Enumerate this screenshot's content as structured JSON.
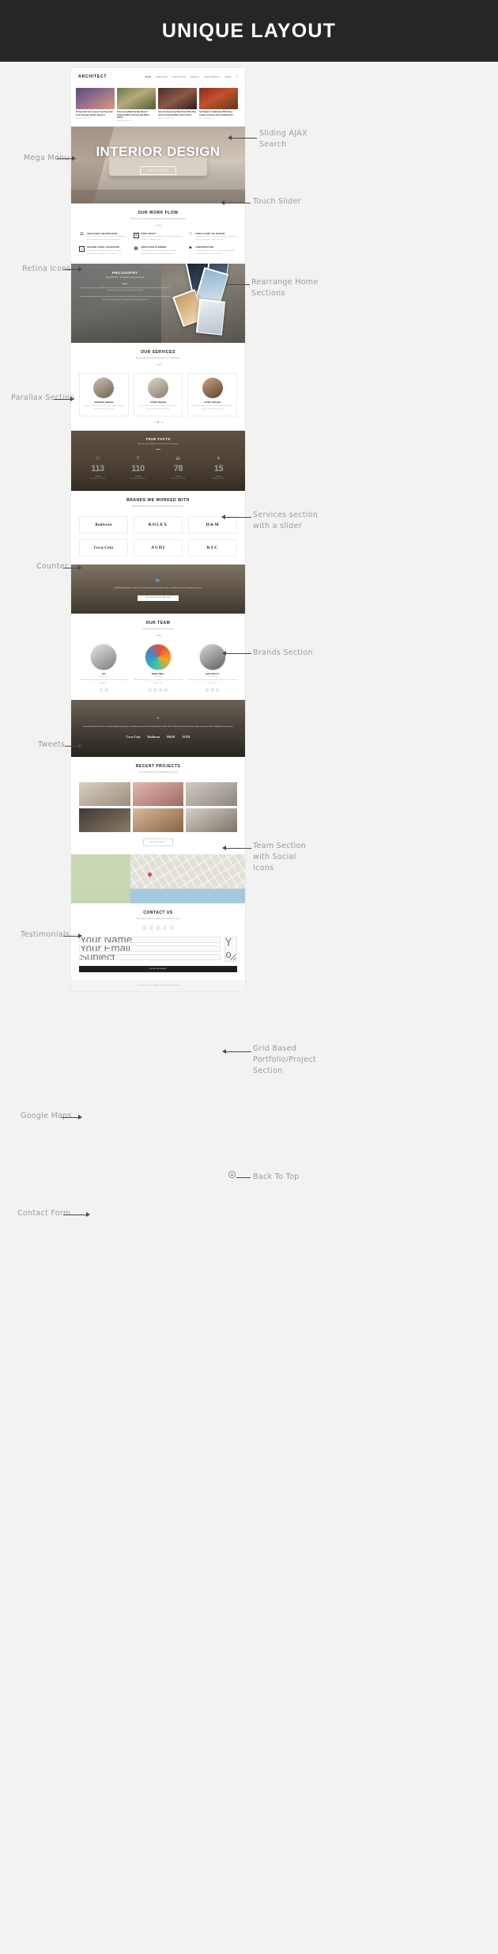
{
  "banner": {
    "title": "UNIQUE LAYOUT"
  },
  "site": {
    "logo": "ARCHITECT",
    "nav": [
      {
        "label": "HOME",
        "icon": "home-icon"
      },
      {
        "label": "SERVICES"
      },
      {
        "label": "PORTFOLIO"
      },
      {
        "label": "PAGES ▾"
      },
      {
        "label": "MEGA MENU ▾"
      },
      {
        "label": "BLOG"
      }
    ],
    "search_icon": "search-icon"
  },
  "mega_menu": {
    "posts": [
      {
        "title": "25 Important Life Lessons You Can Learn From 'Stranger Things' Season 4",
        "meta": "March 26, 2016   •   175"
      },
      {
        "title": "These Incredible Portraits Weren't Captured With A Camera, But With A Pencil.",
        "meta": "March 26, 2016   •   175"
      },
      {
        "title": "Here Are Some Cats Who Prove Why They Aren't Considered Man's Best Friend.",
        "meta": "March 26, 2016   •   175"
      },
      {
        "title": "Get Ready For Halloween With These Couple Costumes That Actually Rock.",
        "meta": "March 26, 2016   •   175"
      }
    ]
  },
  "hero": {
    "title": "INTERIOR DESIGN",
    "button": "OUR PORTFOLIO"
  },
  "workflow": {
    "title": "OUR WORK FLOW",
    "subtitle": "Pushing the boundaries between\nprogressive and innovative.",
    "items": [
      {
        "icon": "☰",
        "heading": "ANALYZING THE PROGRAM",
        "text": "Lorem ipsum dolor sit amet, consectetur adipiscing elit. Suspendisse ut tortor sed velit tempus."
      },
      {
        "icon": "⊕",
        "heading": "FIRST DRAFT",
        "text": "Interdum et malesuada fames ac ante ipsum primis in faucibus. Vestibulum ante."
      },
      {
        "icon": "♡",
        "heading": "FIRST CLIENT VALIDATION",
        "text": "Nam laoreet neque sed dignissim blandit. Ut tincidunt ligula at nisl pretium, sed luctus velit."
      },
      {
        "icon": "✓",
        "heading": "SECOND CLIENT VALIDATION",
        "text": "Donec rhoncus leo vitae lorem egestas, eget dignissim nunc sodales in hac habitasse."
      },
      {
        "icon": "▦",
        "heading": "EXECUTION PLANNING",
        "text": "Phasellus sed quam vel nibh maximus tempor. Praesent ac mauris et nisl semper posuere."
      },
      {
        "icon": "⚑",
        "heading": "CONSTRUCTION",
        "text": "Curabitur vitae lacus in nunc gravida efficitur. Morbi vel erat non justo tincidunt ornare."
      }
    ]
  },
  "philosophy": {
    "title": "PHILOSOPHY",
    "quote": "\"Sky is the limit\" - the\nwords we live and work by.",
    "paragraph1": "Integer sit amet ligula turpis. Aliquam erat volutpat. Maecenas volutpat sapien eu velit suscipit facilisis consectetur. Donec sit amet lectus mauris interdum gravida mi at ipsum.",
    "paragraph2": "Interdum et malesuada fames ac ante ipsum primis in faucibus. Nulla nec lorem nisl sed commodo pulvinar est in malesuade lorem ipsum at quam posuere, egestas tellus id consequat felis."
  },
  "services": {
    "title": "OUR SERVICES",
    "subtitle": "We provide top notch services\nfor our customers.",
    "items": [
      {
        "heading": "INTERIOR DESIGN",
        "text": "Lorem ipsum dolor sit amet, consectetur adipiscing elit quis nulla facilisi vel sem ut augue."
      },
      {
        "heading": "STORE DESIGN",
        "text": "Donec rhoncus leo vitae lorem egestas, eget dignissim nunc sodales at non nisl semper."
      },
      {
        "heading": "HOTEL DESIGN",
        "text": "Phasellus sed quam vel nibh maximus tempor. Praesent ac mauris et nisl semper posuere."
      }
    ],
    "slider_dots": 3,
    "slider_active": 1
  },
  "counter": {
    "title": "TRUE FACTS",
    "subtitle": "Here are some simple, true facts\nabout our company.",
    "items": [
      {
        "icon": "☑",
        "value": "113",
        "label": "PROJECTS DONE"
      },
      {
        "icon": "⏱",
        "value": "110",
        "label": "HOURS WORKED"
      },
      {
        "icon": "☕",
        "value": "78",
        "label": "CUPS OF COFFEE"
      },
      {
        "icon": "♟",
        "value": "15",
        "label": "AWARDS WON"
      }
    ]
  },
  "brands": {
    "title": "BRANDS WE WORKED WITH",
    "subtitle": "We've worked with many great\ncompanies over the years.",
    "items": [
      "Radisson",
      "ROLEX",
      "H&M",
      "Coca-Cola",
      "AUDI",
      "KFC"
    ]
  },
  "tweets": {
    "icon": "twitter-bird-icon",
    "text": "@WPThemeHi please contact us on support team@michaelastou.com, our affiliate was are fine without any issue.",
    "button": "FOLLOW US ON TWITTER"
  },
  "team": {
    "title": "OUR TEAM",
    "subtitle": "Group of people behind the\nmagic.",
    "members": [
      {
        "name": "MIA",
        "role": "Lead Designer",
        "text": "Vestibulum ante ipsum primis in faucibus orci luctus et ultrices posuere cubilia curae.",
        "socials": 2
      },
      {
        "name": "BRAD PINKY",
        "role": "Art Director",
        "text": "Vestibulum ante ipsum primis in faucibus orci luctus et ultrices posuere cubilia curae.",
        "socials": 4
      },
      {
        "name": "SAM SPACIAL",
        "role": "Project Manager",
        "text": "Vestibulum ante ipsum primis in faucibus orci luctus et ultrices posuere cubilia curae.",
        "socials": 3
      }
    ]
  },
  "testimonials": {
    "quote_glyph": "”",
    "text": "Lorem ipsum dolor sit amet, consectetur adipiscing elit, quis commodo monoconsilh, non tincidunt dolo melon sed. Vestibulum ante ipsum donec neque mauris quis nulla, vestibulum ante ipsum at.",
    "logos": [
      "Coca-Cola",
      "Radisson",
      "H&M",
      "AUDI"
    ]
  },
  "projects": {
    "title": "RECENT PROJECTS",
    "subtitle": "Our newest and most outstanding\nprojects.",
    "count": 6,
    "button": "ALL PROJECTS"
  },
  "map": {
    "pin": "map-pin-icon"
  },
  "contact": {
    "title": "CONTACT US",
    "subtitle": "Get in touch with us, we'd love\nto hear from you.",
    "socials": 5,
    "fields": [
      {
        "placeholder": "Your Name"
      },
      {
        "placeholder": "Your Email"
      },
      {
        "placeholder": "Subject"
      }
    ],
    "message_placeholder": "Your Message",
    "submit": "SEND MESSAGE"
  },
  "footer": {
    "text": "© 2016 ARCHITECT THEME. ALL RIGHTS RESERVED."
  },
  "annotations": {
    "mega_menu": "Mega Menu",
    "retina_icons": "Retina Icons",
    "parallax": "Parallax Section",
    "counter": "Counter",
    "tweets": "Tweets",
    "testimonials": "Testimonials",
    "google_maps": "Google Maps",
    "contact_form": "Contact Form",
    "ajax_search": "Sliding AJAX\nSearch",
    "touch_slider": "Touch Slider",
    "rearrange": "Rearrange Home\nSections",
    "services_slider": "Services section\nwith a slider",
    "brands": "Brands Section",
    "team": "Team Section\nwith Social\nIcons",
    "portfolio": "Grid Based\nPortfolio/Project\nSection",
    "back_to_top": "Back To Top",
    "back_to_top_icon": "▲"
  }
}
